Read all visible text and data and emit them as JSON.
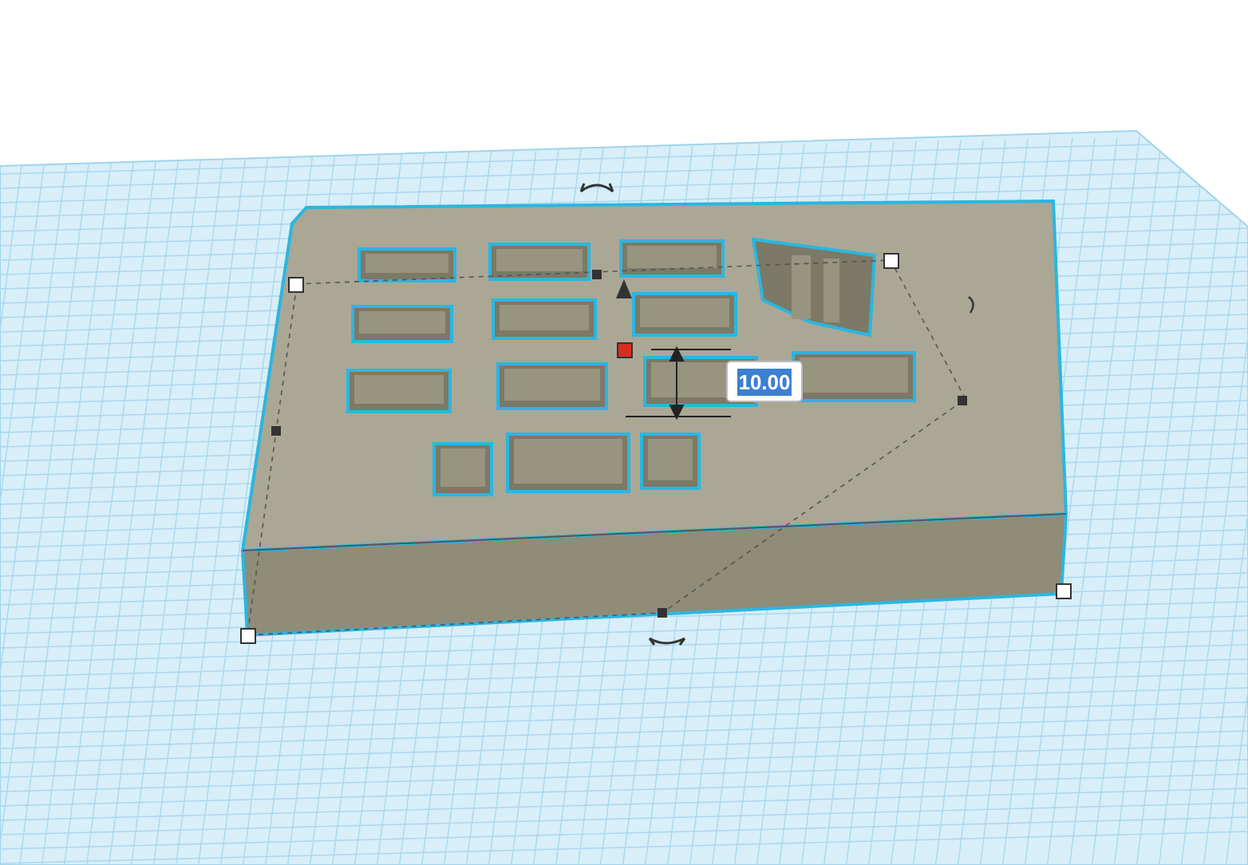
{
  "dimension_field": {
    "value": "10.00",
    "selected": true
  }
}
